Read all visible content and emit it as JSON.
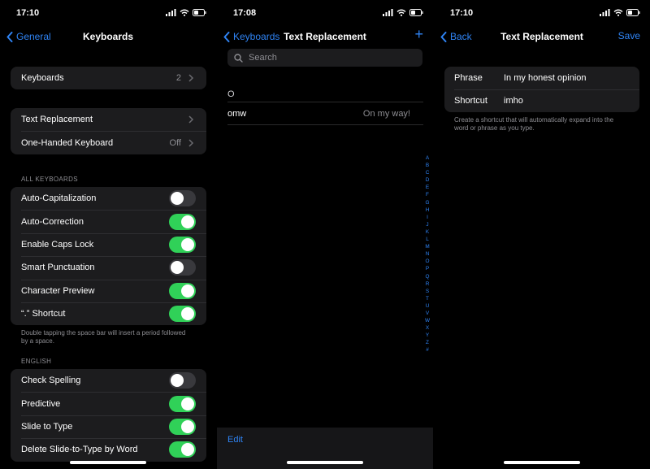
{
  "screen1": {
    "time": "17:10",
    "back_label": "General",
    "title": "Keyboards",
    "keyboards": {
      "label": "Keyboards",
      "value": "2"
    },
    "text_replacement": {
      "label": "Text Replacement"
    },
    "one_handed": {
      "label": "One-Handed Keyboard",
      "value": "Off"
    },
    "all_keyboards_header": "ALL KEYBOARDS",
    "all_keyboards": [
      {
        "label": "Auto-Capitalization",
        "on": false
      },
      {
        "label": "Auto-Correction",
        "on": true
      },
      {
        "label": "Enable Caps Lock",
        "on": true
      },
      {
        "label": "Smart Punctuation",
        "on": false
      },
      {
        "label": "Character Preview",
        "on": true
      },
      {
        "label": "“.” Shortcut",
        "on": true
      }
    ],
    "shortcut_note": "Double tapping the space bar will insert a period followed by a space.",
    "english_header": "ENGLISH",
    "english": [
      {
        "label": "Check Spelling",
        "on": false
      },
      {
        "label": "Predictive",
        "on": true
      },
      {
        "label": "Slide to Type",
        "on": true
      },
      {
        "label": "Delete Slide-to-Type by Word",
        "on": true
      }
    ]
  },
  "screen2": {
    "time": "17:08",
    "back_label": "Keyboards",
    "title": "Text Replacement",
    "add_symbol": "+",
    "search_placeholder": "Search",
    "section_header": "O",
    "items": [
      {
        "shortcut": "omw",
        "phrase": "On my way!"
      }
    ],
    "index_letters": [
      "A",
      "B",
      "C",
      "D",
      "E",
      "F",
      "G",
      "H",
      "I",
      "J",
      "K",
      "L",
      "M",
      "N",
      "O",
      "P",
      "Q",
      "R",
      "S",
      "T",
      "U",
      "V",
      "W",
      "X",
      "Y",
      "Z",
      "#"
    ],
    "edit_label": "Edit"
  },
  "screen3": {
    "time": "17:10",
    "back_label": "Back",
    "title": "Text Replacement",
    "save_label": "Save",
    "phrase_label": "Phrase",
    "phrase_value": "In my honest opinion",
    "shortcut_label": "Shortcut",
    "shortcut_value": "imho",
    "help": "Create a shortcut that will automatically expand into the word or phrase as you type."
  },
  "colors": {
    "accent": "#2f84f5",
    "toggle_on": "#30d158",
    "cell_bg": "#1c1c1e"
  },
  "icons": [
    "signal-icon",
    "wifi-icon",
    "battery-icon",
    "chevron-left-icon",
    "chevron-right-icon",
    "plus-icon",
    "search-icon"
  ]
}
